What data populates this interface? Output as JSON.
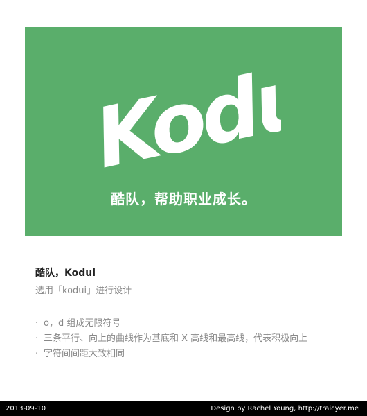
{
  "banner": {
    "logo_text": "Kodui",
    "slogan": "酷队，帮助职业成长。",
    "background_color": "#5aae6b"
  },
  "content": {
    "title": "酷队，Kodui",
    "subtitle": "选用「kodui」进行设计",
    "bullets": [
      "o，d 组成无限符号",
      "三条平行、向上的曲线作为基底和 X 高线和最高线，代表积极向上",
      "字符间间距大致相同"
    ],
    "bullet_marker": "·"
  },
  "footer": {
    "date": "2013-09-10",
    "credit": "Design by Rachel Young, http://traicyer.me"
  }
}
